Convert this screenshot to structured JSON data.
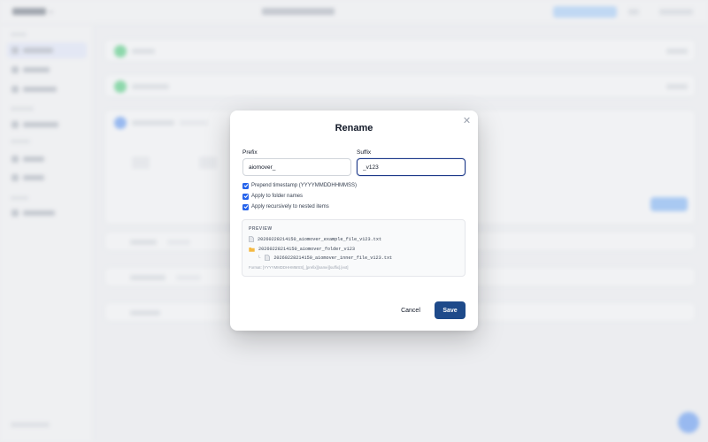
{
  "dialog": {
    "title": "Rename",
    "prefix": {
      "label": "Prefix",
      "value": "aiomover_"
    },
    "suffix": {
      "label": "Suffix",
      "value": "_v123"
    },
    "options": [
      {
        "label": "Prepend timestamp (YYYYMMDDHHMMSS)",
        "checked": true
      },
      {
        "label": "Apply to folder names",
        "checked": true
      },
      {
        "label": "Apply recursively to nested items",
        "checked": true
      }
    ],
    "preview": {
      "heading": "PREVIEW",
      "items": [
        {
          "icon": "file-icon",
          "text": "20260228214150_aiomover_example_file_v123.txt"
        },
        {
          "icon": "folder-icon",
          "text": "20260228214150_aiomover_folder_v123"
        },
        {
          "icon": "file-icon",
          "text": "20260228214150_aiomover_inner_file_v123.txt",
          "nested": true
        }
      ],
      "format": "Format: [YYYYMMDDHHMMSS]_[prefix][name][suffix].[ext]"
    },
    "cancel_label": "Cancel",
    "save_label": "Save",
    "close_glyph": "✕",
    "accent_color": "#1e4a8a",
    "checkbox_color": "#2563eb",
    "folder_color": "#f5b942"
  }
}
